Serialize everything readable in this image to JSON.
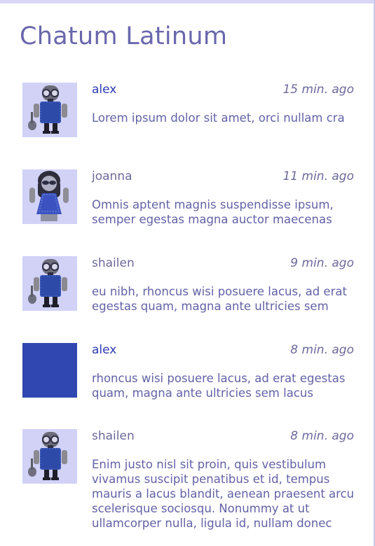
{
  "app": {
    "title": "Chatum Latinum"
  },
  "colors": {
    "accent": "#2d3ab2",
    "avatar_background": "#d1d2f6",
    "blank_avatar": "#3047b1"
  },
  "messages": [
    {
      "user": "alex",
      "time": "15 min. ago",
      "text": "Lorem ipsum dolor sit amet, orci nullam cra",
      "avatar": "guitar-player-avatar-icon"
    },
    {
      "user": "joanna",
      "time": "11 min. ago",
      "text": "Omnis aptent magnis suspendisse ipsum, semper egestas magna auctor maecenas",
      "avatar": "woman-sunglasses-avatar-icon"
    },
    {
      "user": "shailen",
      "time": "9 min. ago",
      "text": "eu nibh, rhoncus wisi posuere lacus, ad erat egestas quam, magna ante ultricies sem",
      "avatar": "guitar-player-avatar-icon"
    },
    {
      "user": "alex",
      "time": "8 min. ago",
      "text": "rhoncus wisi posuere lacus, ad erat egestas quam, magna ante ultricies sem lacus",
      "avatar": "blank-avatar"
    },
    {
      "user": "shailen",
      "time": "8 min. ago",
      "text": "Enim justo nisl sit proin, quis vestibulum vivamus suscipit penatibus et id, tempus mauris a lacus blandit, aenean praesent arcu scelerisque sociosqu. Nonummy at ut ullamcorper nulla, ligula id, nullam donec",
      "avatar": "guitar-player-avatar-icon"
    }
  ]
}
